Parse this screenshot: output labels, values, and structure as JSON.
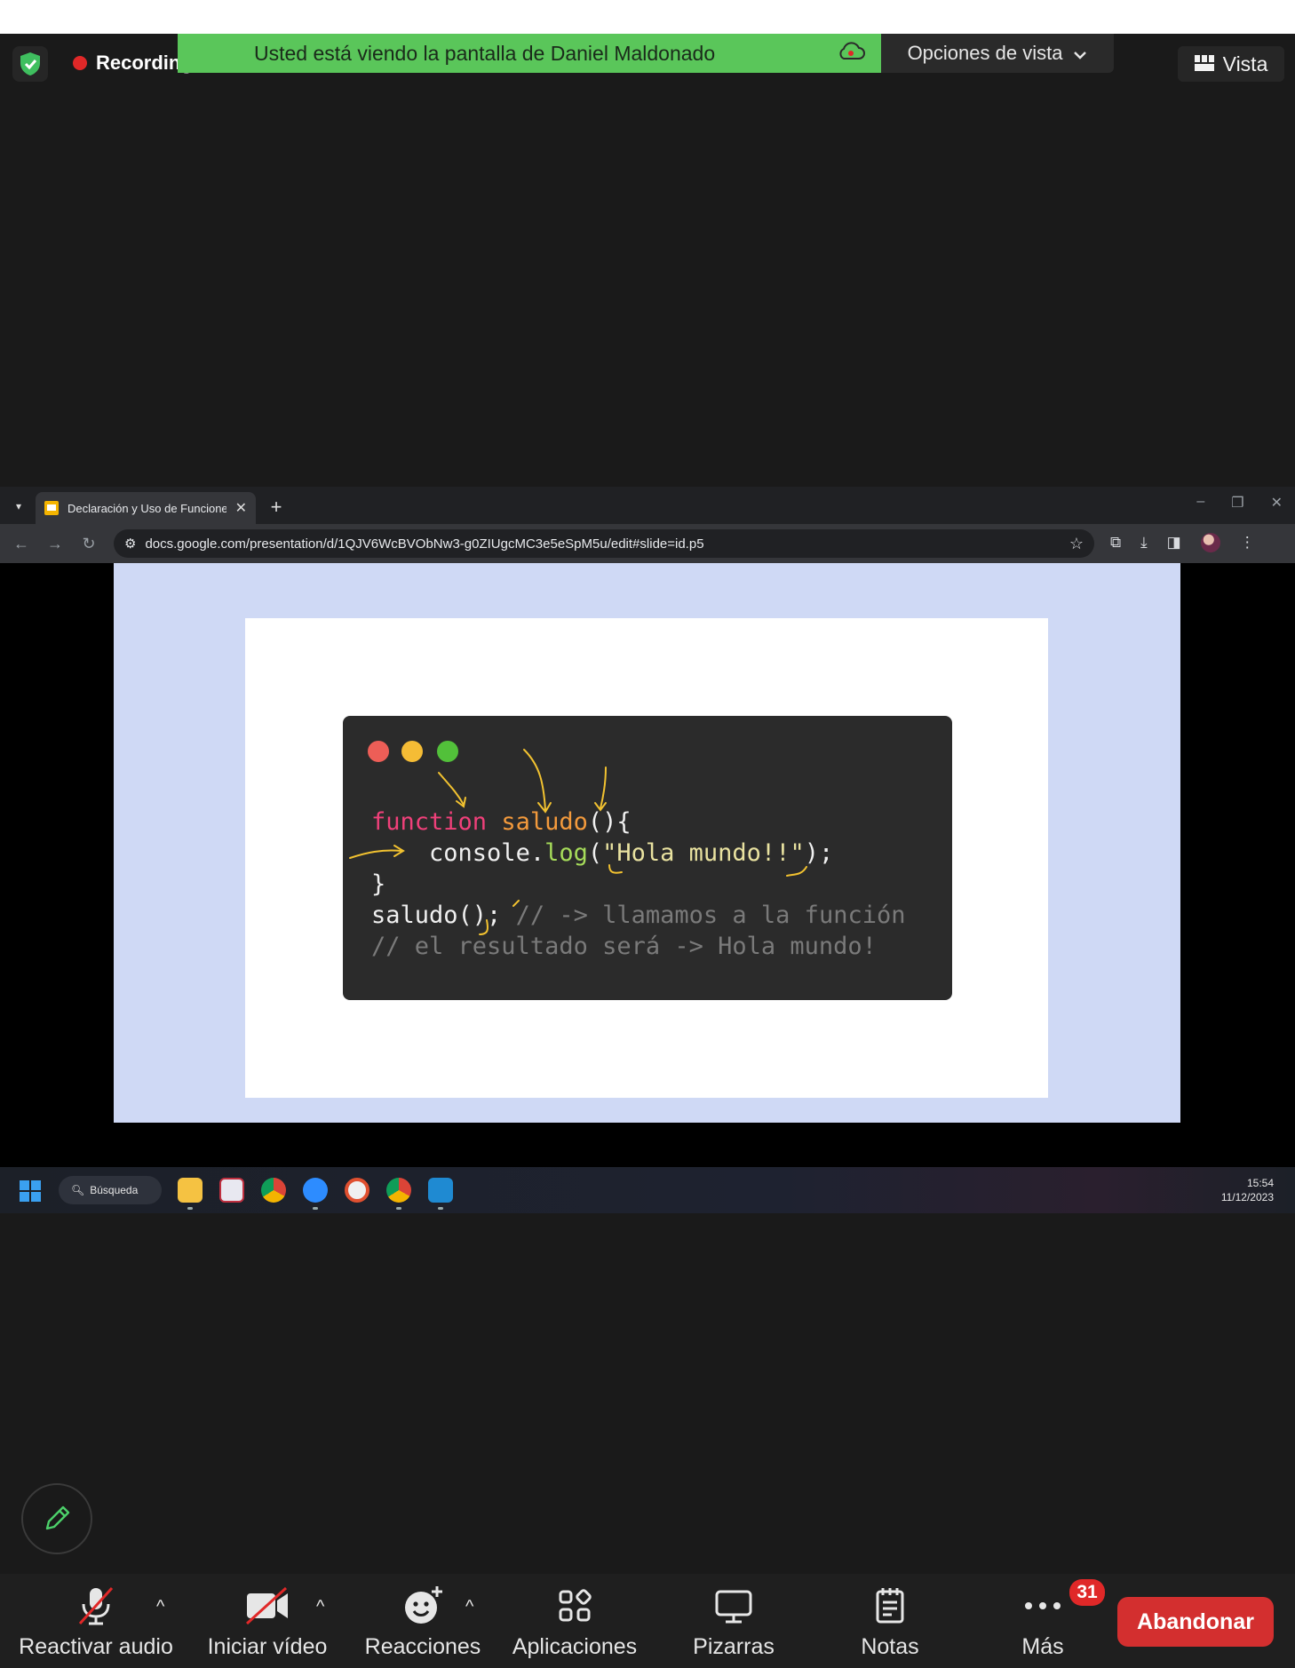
{
  "meeting": {
    "recording_label": "Recording",
    "share_banner": "Usted está viendo la pantalla de Daniel Maldonado",
    "view_options": "Opciones de vista",
    "view_button": "Vista"
  },
  "browser": {
    "tab_title": "Declaración y Uso de Funciones",
    "url": "docs.google.com/presentation/d/1QJV6WcBVObNw3-g0ZIUgcMC3e5eSpM5u/edit#slide=id.p5"
  },
  "slide": {
    "code": {
      "keyword_function": "function",
      "fn_name": "saludo",
      "fn_parens": "(){",
      "console": "console.",
      "log": "log",
      "paren_open": "(",
      "string": "\"Hola mundo!!\"",
      "paren_close": ");",
      "close_brace": "}",
      "call": "saludo();",
      "comment1": "// -> llamamos a la función",
      "comment2": "// el resultado será -> Hola mundo!"
    }
  },
  "taskbar": {
    "search_label": "Búsqueda",
    "time": "15:54",
    "date": "11/12/2023",
    "apps": [
      "file-explorer-icon",
      "snipping-tool-icon",
      "chrome-icon",
      "zoom-icon",
      "app-icon",
      "chrome-profile-icon",
      "vscode-icon"
    ]
  },
  "toolbar": {
    "audio": "Reactivar audio",
    "video": "Iniciar vídeo",
    "reactions": "Reacciones",
    "apps": "Aplicaciones",
    "whiteboards": "Pizarras",
    "notes": "Notas",
    "more": "Más",
    "more_badge": "31",
    "leave": "Abandonar"
  },
  "colors": {
    "banner": "#5ac65a",
    "leave": "#d32f2f",
    "slide_bg": "#cfd9f5",
    "code_bg": "#2b2b2b"
  }
}
